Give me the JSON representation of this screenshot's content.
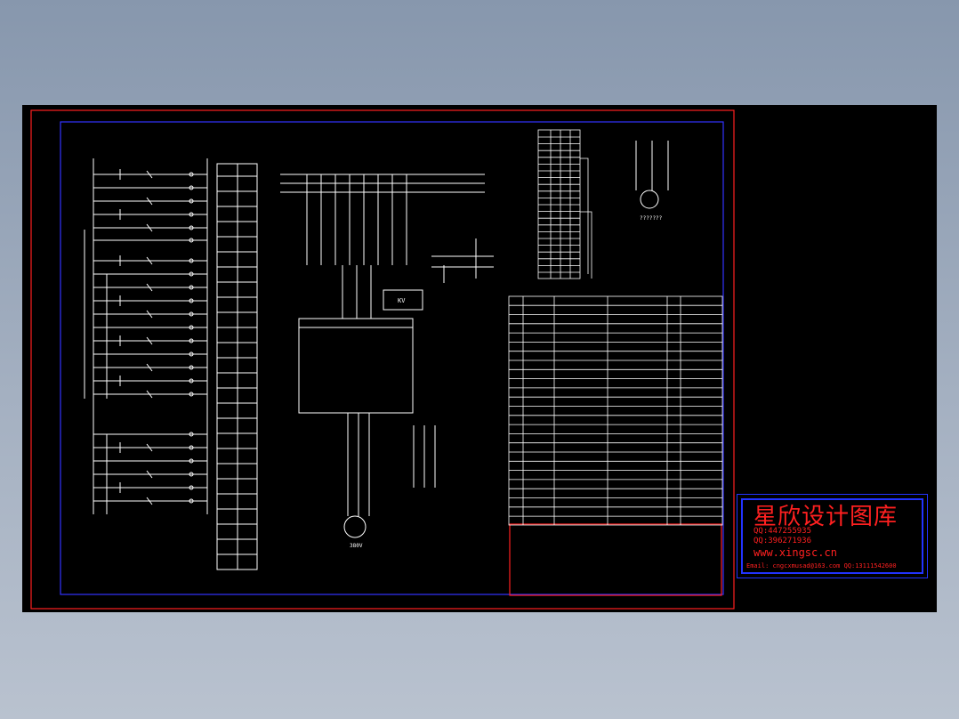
{
  "stamp": {
    "title": "星欣设计图库",
    "qq1": "QQ:447255935",
    "qq2": "QQ:396271936",
    "website": "www.xingsc.cn",
    "email": "Email: cngcxmusad@163.com  QQ:13111542600"
  },
  "diagram": {
    "motor_label": "380V",
    "controller_label": "KV",
    "small_motor_question": "???????"
  },
  "colors": {
    "outer_border": "#ff2020",
    "inner_border": "#3333ff",
    "lines": "#ffffff",
    "background": "#000000"
  }
}
